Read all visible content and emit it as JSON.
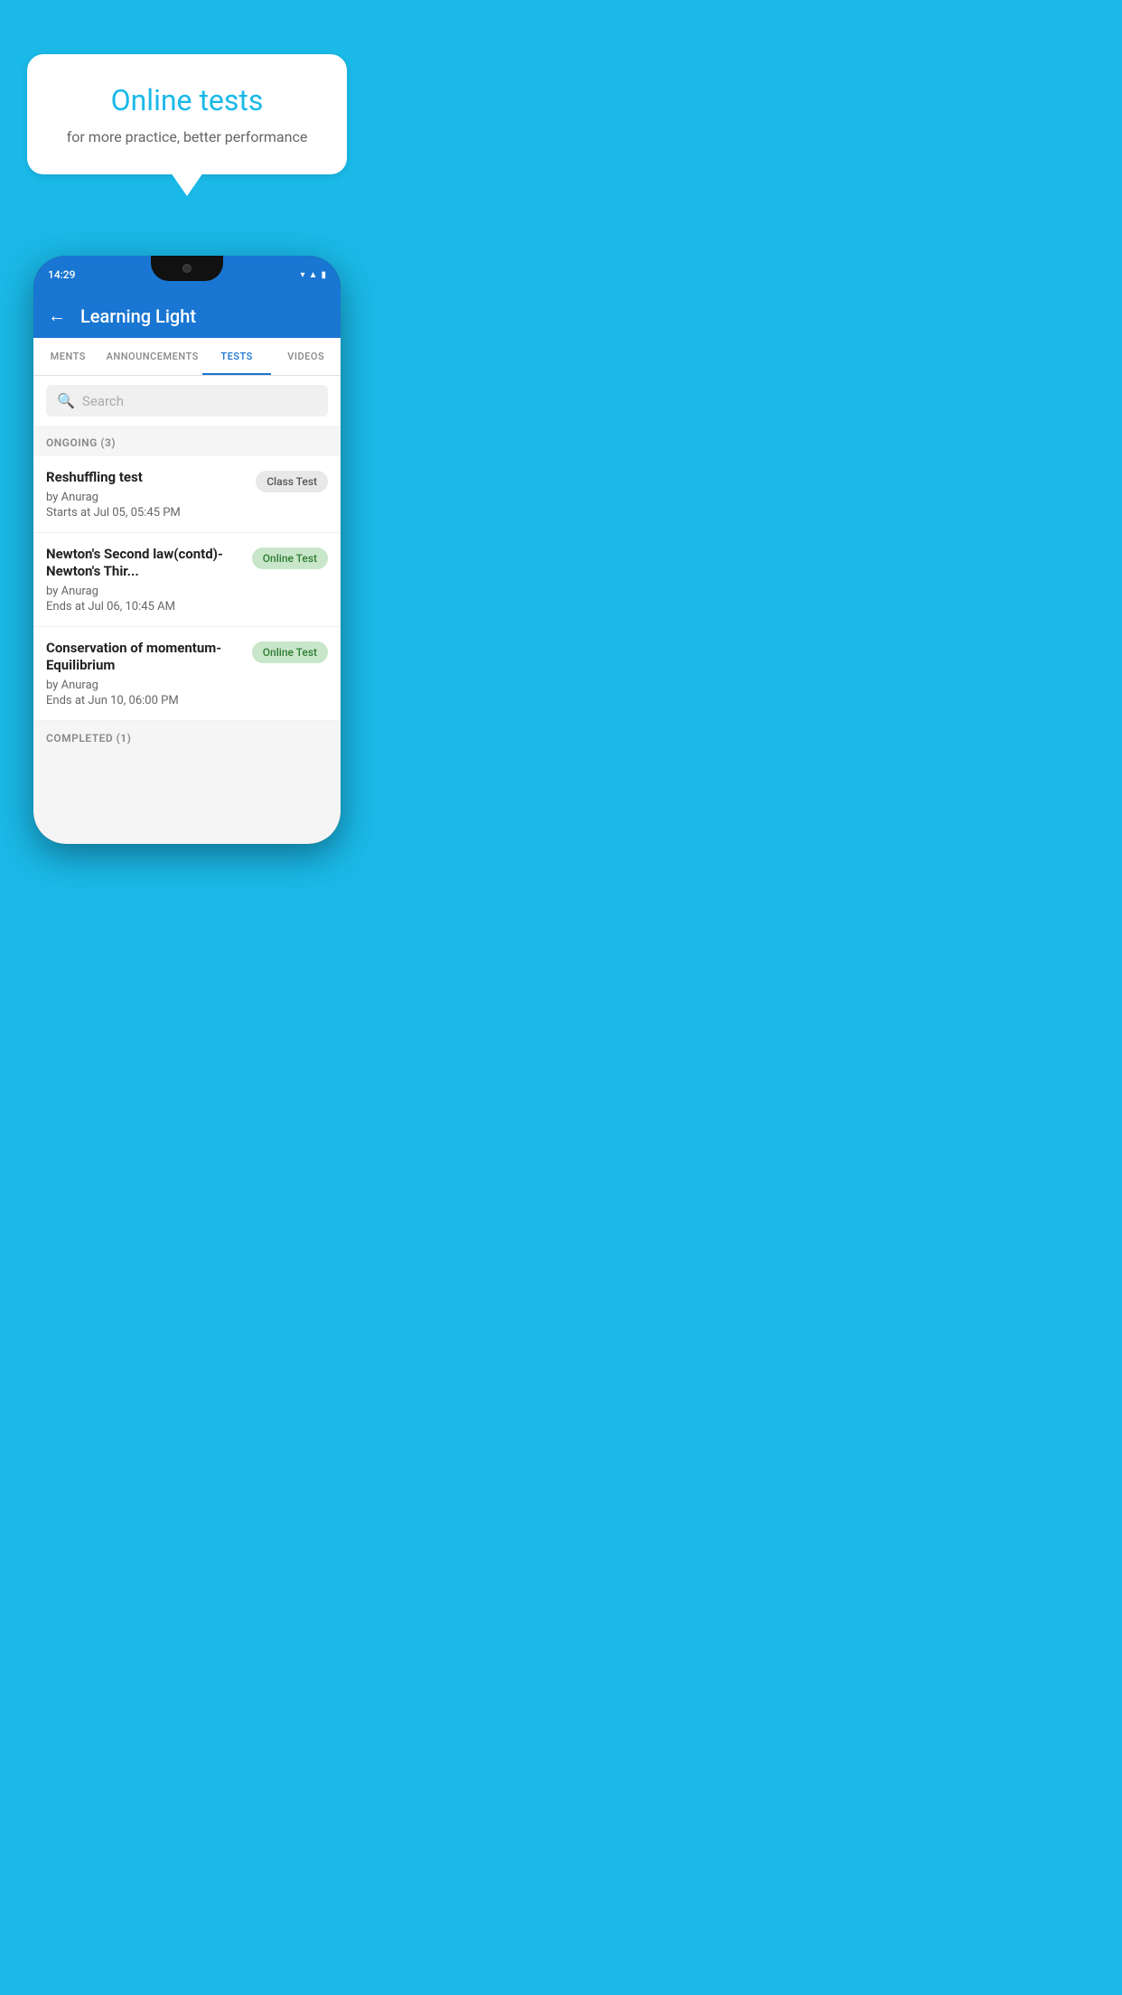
{
  "background_color": "#1ab9e8",
  "hero": {
    "title": "Online tests",
    "subtitle": "for more practice, better performance"
  },
  "phone": {
    "status_bar": {
      "time": "14:29",
      "icons": [
        "wifi",
        "signal",
        "battery"
      ]
    },
    "app_bar": {
      "title": "Learning Light",
      "back_label": "←"
    },
    "tabs": [
      {
        "label": "MENTS",
        "active": false
      },
      {
        "label": "ANNOUNCEMENTS",
        "active": false
      },
      {
        "label": "TESTS",
        "active": true
      },
      {
        "label": "VIDEOS",
        "active": false
      }
    ],
    "search": {
      "placeholder": "Search"
    },
    "ongoing_section": {
      "header": "ONGOING (3)",
      "items": [
        {
          "name": "Reshuffling test",
          "author": "by Anurag",
          "date": "Starts at  Jul 05, 05:45 PM",
          "badge": "Class Test",
          "badge_type": "class"
        },
        {
          "name": "Newton's Second law(contd)-Newton's Thir...",
          "author": "by Anurag",
          "date": "Ends at  Jul 06, 10:45 AM",
          "badge": "Online Test",
          "badge_type": "online"
        },
        {
          "name": "Conservation of momentum-Equilibrium",
          "author": "by Anurag",
          "date": "Ends at  Jun 10, 06:00 PM",
          "badge": "Online Test",
          "badge_type": "online"
        }
      ]
    },
    "completed_section": {
      "header": "COMPLETED (1)"
    }
  }
}
